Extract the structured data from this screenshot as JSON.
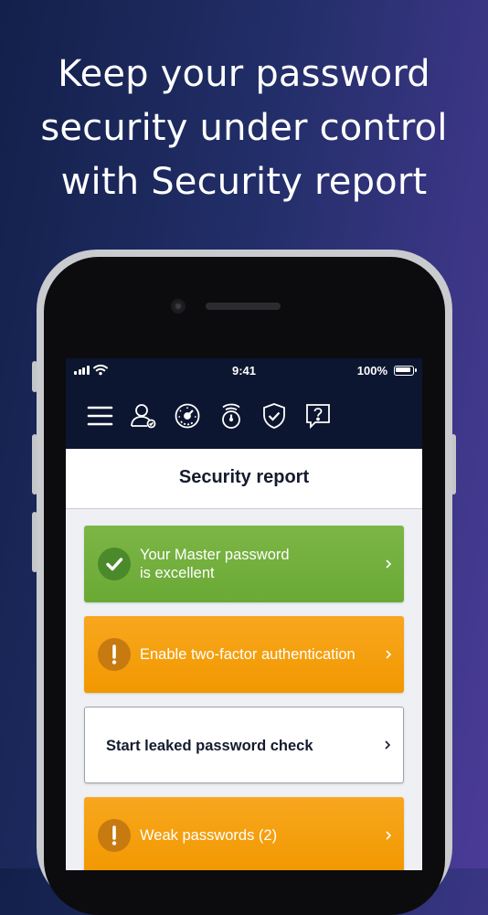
{
  "headline": {
    "line1": "Keep your password",
    "line2": "security under control",
    "line3": "with Security report"
  },
  "status_bar": {
    "time": "9:41",
    "battery": "100%"
  },
  "navbar": {
    "icons": [
      "menu-icon",
      "user-account-icon",
      "dashboard-gauge-icon",
      "password-generator-icon",
      "security-shield-icon",
      "help-icon"
    ]
  },
  "screen": {
    "title": "Security report"
  },
  "cards": [
    {
      "label": "Your Master password\nis excellent",
      "status": "success",
      "color": "#6fae3b"
    },
    {
      "label": "Enable two-factor authentication",
      "status": "warning",
      "color": "#f5a00e"
    },
    {
      "label": "Start leaked password check",
      "status": "action",
      "color": "#ffffff"
    },
    {
      "label": "Weak passwords (2)",
      "status": "warning",
      "color": "#f5a00e"
    }
  ],
  "colors": {
    "navbar": "#0c1630",
    "success": "#6fae3b",
    "warning": "#f5a00e"
  }
}
